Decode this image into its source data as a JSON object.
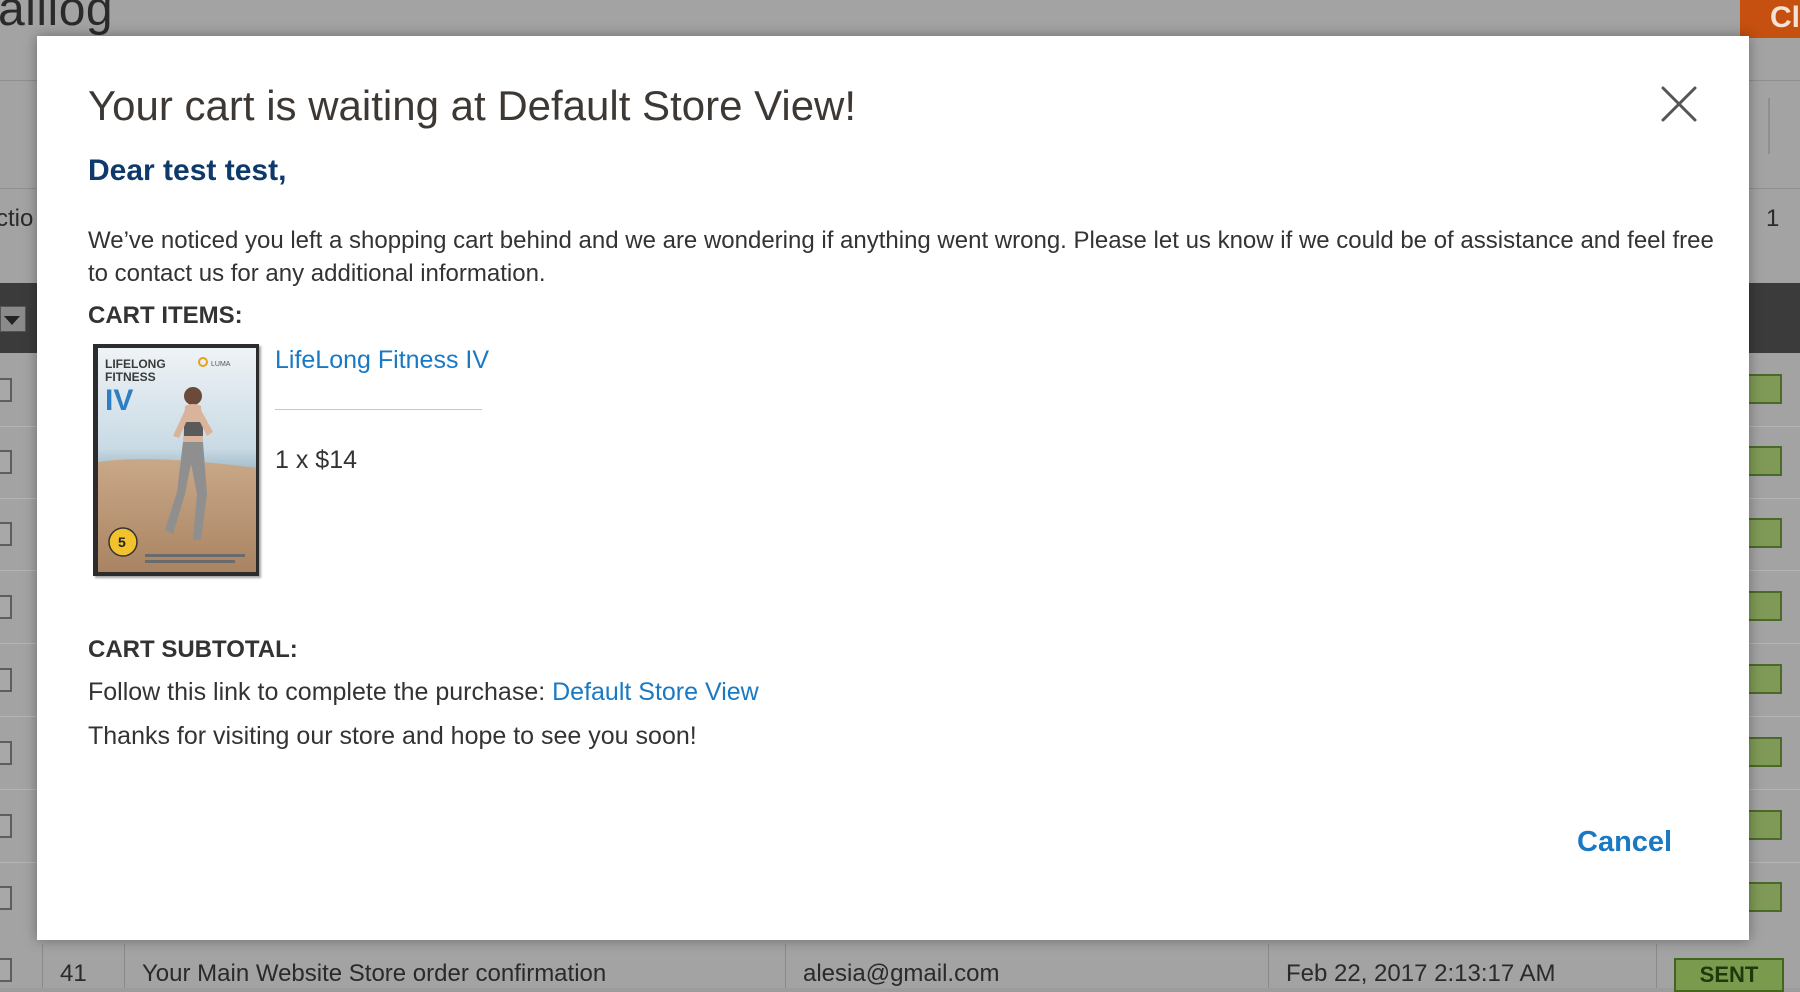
{
  "background": {
    "page_title": "aillog",
    "top_right_button": "Cl",
    "action_label": "ctio",
    "pager_value": "1",
    "last_row": {
      "id": "41",
      "subject": "Your Main Website Store order confirmation",
      "email": "alesia@gmail.com",
      "date": "Feb 22, 2017 2:13:17 AM",
      "status": "SENT"
    }
  },
  "modal": {
    "title": "Your cart is waiting at Default Store View!",
    "greeting": "Dear test test,",
    "intro": "We’ve noticed you left a shopping cart behind and we are wondering if anything went wrong. Please let us know if we could be of assistance and feel free to contact us for any additional information.",
    "cart_items_label": "CART ITEMS:",
    "items": [
      {
        "name": "LifeLong Fitness IV",
        "qty_price": "1 x $14",
        "thumb": {
          "line1": "LIFELONG",
          "line2": "FITNESS",
          "line3": "IV",
          "brand": "LUMA",
          "badge": "5"
        }
      }
    ],
    "subtotal_label": "CART SUBTOTAL:",
    "follow_text": "Follow this link to complete the purchase:",
    "store_link": "Default Store View",
    "thanks": "Thanks for visiting our store and hope to see you soon!",
    "cancel_label": "Cancel"
  },
  "icons": {
    "close": "close-icon"
  },
  "colors": {
    "link": "#1979c3",
    "greeting": "#0d3a6b",
    "status_green": "#7a9a4d",
    "orange_button": "#c5500f"
  }
}
